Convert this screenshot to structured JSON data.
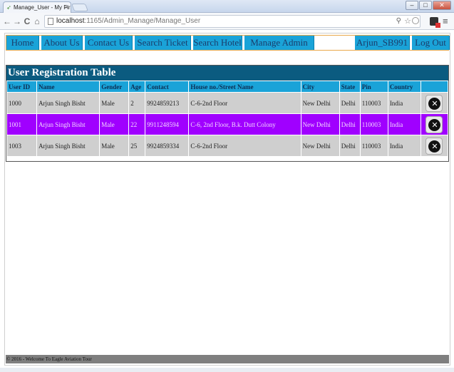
{
  "browser": {
    "tab_title": "Manage_User - My First A",
    "tab_close": "×",
    "url_host": "localhost",
    "url_path": ":1165/Admin_Manage/Manage_User",
    "zoom_icon": "⚲",
    "star_icon": "☆",
    "back_icon": "←",
    "forward_icon": "→",
    "reload_icon": "C",
    "home_icon": "⌂",
    "menu_icon": "≡",
    "min_icon": "–",
    "max_icon": "□",
    "close_icon": "✕"
  },
  "nav": {
    "items": [
      "Home",
      "About Us",
      "Contact Us",
      "Search Ticket",
      "Search Hotel",
      "Manage Admin"
    ],
    "user": "Arjun_SB991",
    "logout": "Log Out"
  },
  "table": {
    "title": "User Registration Table",
    "headers": [
      "User ID",
      "Name",
      "Gender",
      "Age",
      "Contact",
      "House no./Street Name",
      "City",
      "State",
      "Pin",
      "Country"
    ],
    "rows": [
      [
        "1000",
        "Arjun Singh Bisht",
        "Male",
        "2",
        "9924859213",
        "C-6-2nd Floor",
        "New Delhi",
        "Delhi",
        "110003",
        "India"
      ],
      [
        "1001",
        "Arjun Singh Bisht",
        "Male",
        "22",
        "9911248594",
        "C-6, 2nd Floor, B.k. Dutt Colony",
        "New Delhi",
        "Delhi",
        "110003",
        "India"
      ],
      [
        "1003",
        "Arjun Singh Bisht",
        "Male",
        "25",
        "9924859334",
        "C-6-2nd Floor",
        "New Delhi",
        "Delhi",
        "110003",
        "India"
      ]
    ],
    "selected_row": 1,
    "delete_glyph": "✕"
  },
  "footer": {
    "text": "© 2016 - Welcome To Eagle Aviation Tour"
  },
  "colors": {
    "nav_bg": "#1aa3d8",
    "caption_bg": "#0b5b80",
    "selected_row": "#a000ff",
    "footer_bg": "#7f7f7f"
  }
}
